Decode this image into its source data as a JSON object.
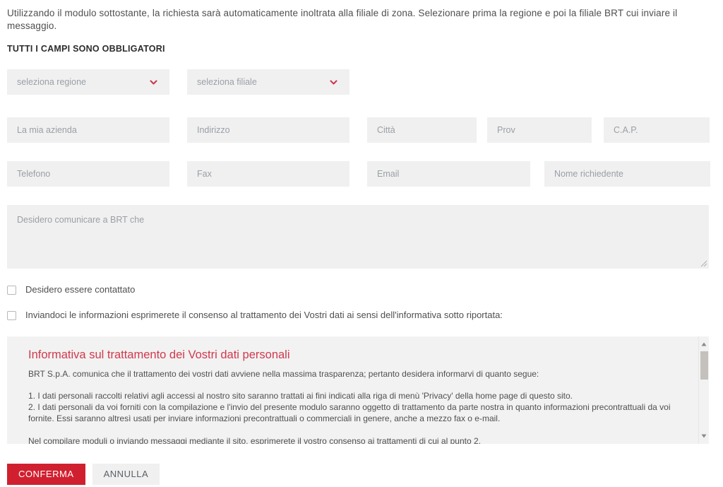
{
  "intro": {
    "text": "Utilizzando il modulo sottostante, la richiesta sarà automaticamente inoltrata alla filiale di zona. Selezionare prima la regione e poi la filiale BRT cui inviare il messaggio.",
    "required_note": "TUTTI I CAMPI SONO OBBLIGATORI"
  },
  "selects": [
    {
      "name": "regione",
      "value": "seleziona regione",
      "icon": "chevron-down-icon"
    },
    {
      "name": "filiale",
      "value": "seleziona filiale",
      "icon": "chevron-down-icon"
    }
  ],
  "fields_row1": [
    {
      "name": "azienda",
      "placeholder": "La mia azienda",
      "value": ""
    },
    {
      "name": "indirizzo",
      "placeholder": "Indirizzo",
      "value": ""
    },
    {
      "name": "citta",
      "placeholder": "Città",
      "value": ""
    },
    {
      "name": "prov",
      "placeholder": "Prov",
      "value": ""
    },
    {
      "name": "cap",
      "placeholder": "C.A.P.",
      "value": ""
    }
  ],
  "fields_row2": [
    {
      "name": "telefono",
      "placeholder": "Telefono",
      "value": ""
    },
    {
      "name": "fax",
      "placeholder": "Fax",
      "value": ""
    },
    {
      "name": "email",
      "placeholder": "Email",
      "value": ""
    },
    {
      "name": "nome_richiedente",
      "placeholder": "Nome richiedente",
      "value": ""
    }
  ],
  "message": {
    "placeholder": "Desidero comunicare a BRT che",
    "value": ""
  },
  "checkboxes": [
    {
      "name": "contattato",
      "label": "Desidero essere contattato",
      "checked": false
    },
    {
      "name": "consenso",
      "label": "Inviandoci le informazioni esprimerete il consenso al trattamento dei Vostri dati ai sensi dell'informativa sotto riportata:",
      "checked": false
    }
  ],
  "privacy": {
    "title": "Informativa sul trattamento dei Vostri dati personali",
    "lead": "BRT S.p.A. comunica che il trattamento dei vostri dati avviene nella massima trasparenza; pertanto desidera informarvi di quanto segue:",
    "point1": "1. I dati personali raccolti relativi agli accessi al nostro sito saranno trattati ai fini indicati alla riga di menù 'Privacy' della home page di questo sito.",
    "point2": "2. I dati personali da voi forniti con la compilazione e l'invio del presente modulo saranno oggetto di trattamento da parte nostra in quanto informazioni precontrattuali da voi fornite. Essi saranno altresì usati per inviare informazioni precontrattuali o commerciali in genere, anche a mezzo fax o e-mail.",
    "tail": "Nel compilare moduli o inviando messaggi mediante il sito, esprimerete il vostro consenso ai trattamenti di cui al punto 2.",
    "scroll_up_icon": "triangle-up-icon",
    "scroll_down_icon": "triangle-down-icon"
  },
  "buttons": {
    "confirm": "CONFERMA",
    "cancel": "ANNULLA"
  },
  "colors": {
    "accent_red": "#d0202f",
    "title_red": "#d1394c",
    "field_bg": "#f0f0f0",
    "panel_bg": "#f2f2f2"
  }
}
